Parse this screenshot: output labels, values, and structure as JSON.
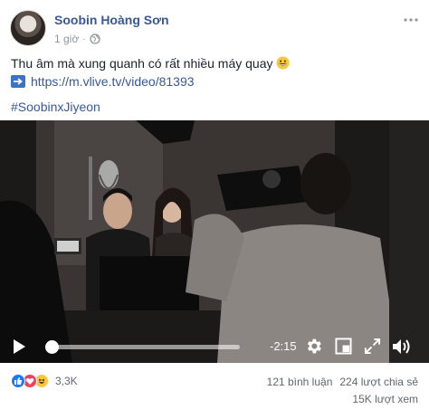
{
  "post": {
    "author": "Soobin Hoàng Sơn",
    "time": "1 giờ",
    "privacy_icon": "globe-icon",
    "text_line": "Thu âm mà xung quanh có rất nhiều máy quay",
    "emoji_icon": "grinning-face-icon",
    "link_icon": "right-arrow-icon",
    "link": "https://m.vlive.tv/video/81393",
    "hashtag": "#SoobinxJiyeon"
  },
  "video": {
    "time_remaining": "-2:15",
    "progress": 0.02,
    "icons": [
      "play-icon",
      "settings-icon",
      "pip-icon",
      "fullscreen-icon",
      "volume-icon"
    ]
  },
  "footer": {
    "reaction_icons": [
      "like-icon",
      "love-icon",
      "haha-icon"
    ],
    "reaction_count": "3,3K",
    "comments": "121 bình luận",
    "shares": "224 lượt chia sẻ",
    "views": "15K lượt xem"
  },
  "colors": {
    "link": "#365899",
    "author": "#385898",
    "meta": "#90949c",
    "video_bg": "#151515"
  }
}
